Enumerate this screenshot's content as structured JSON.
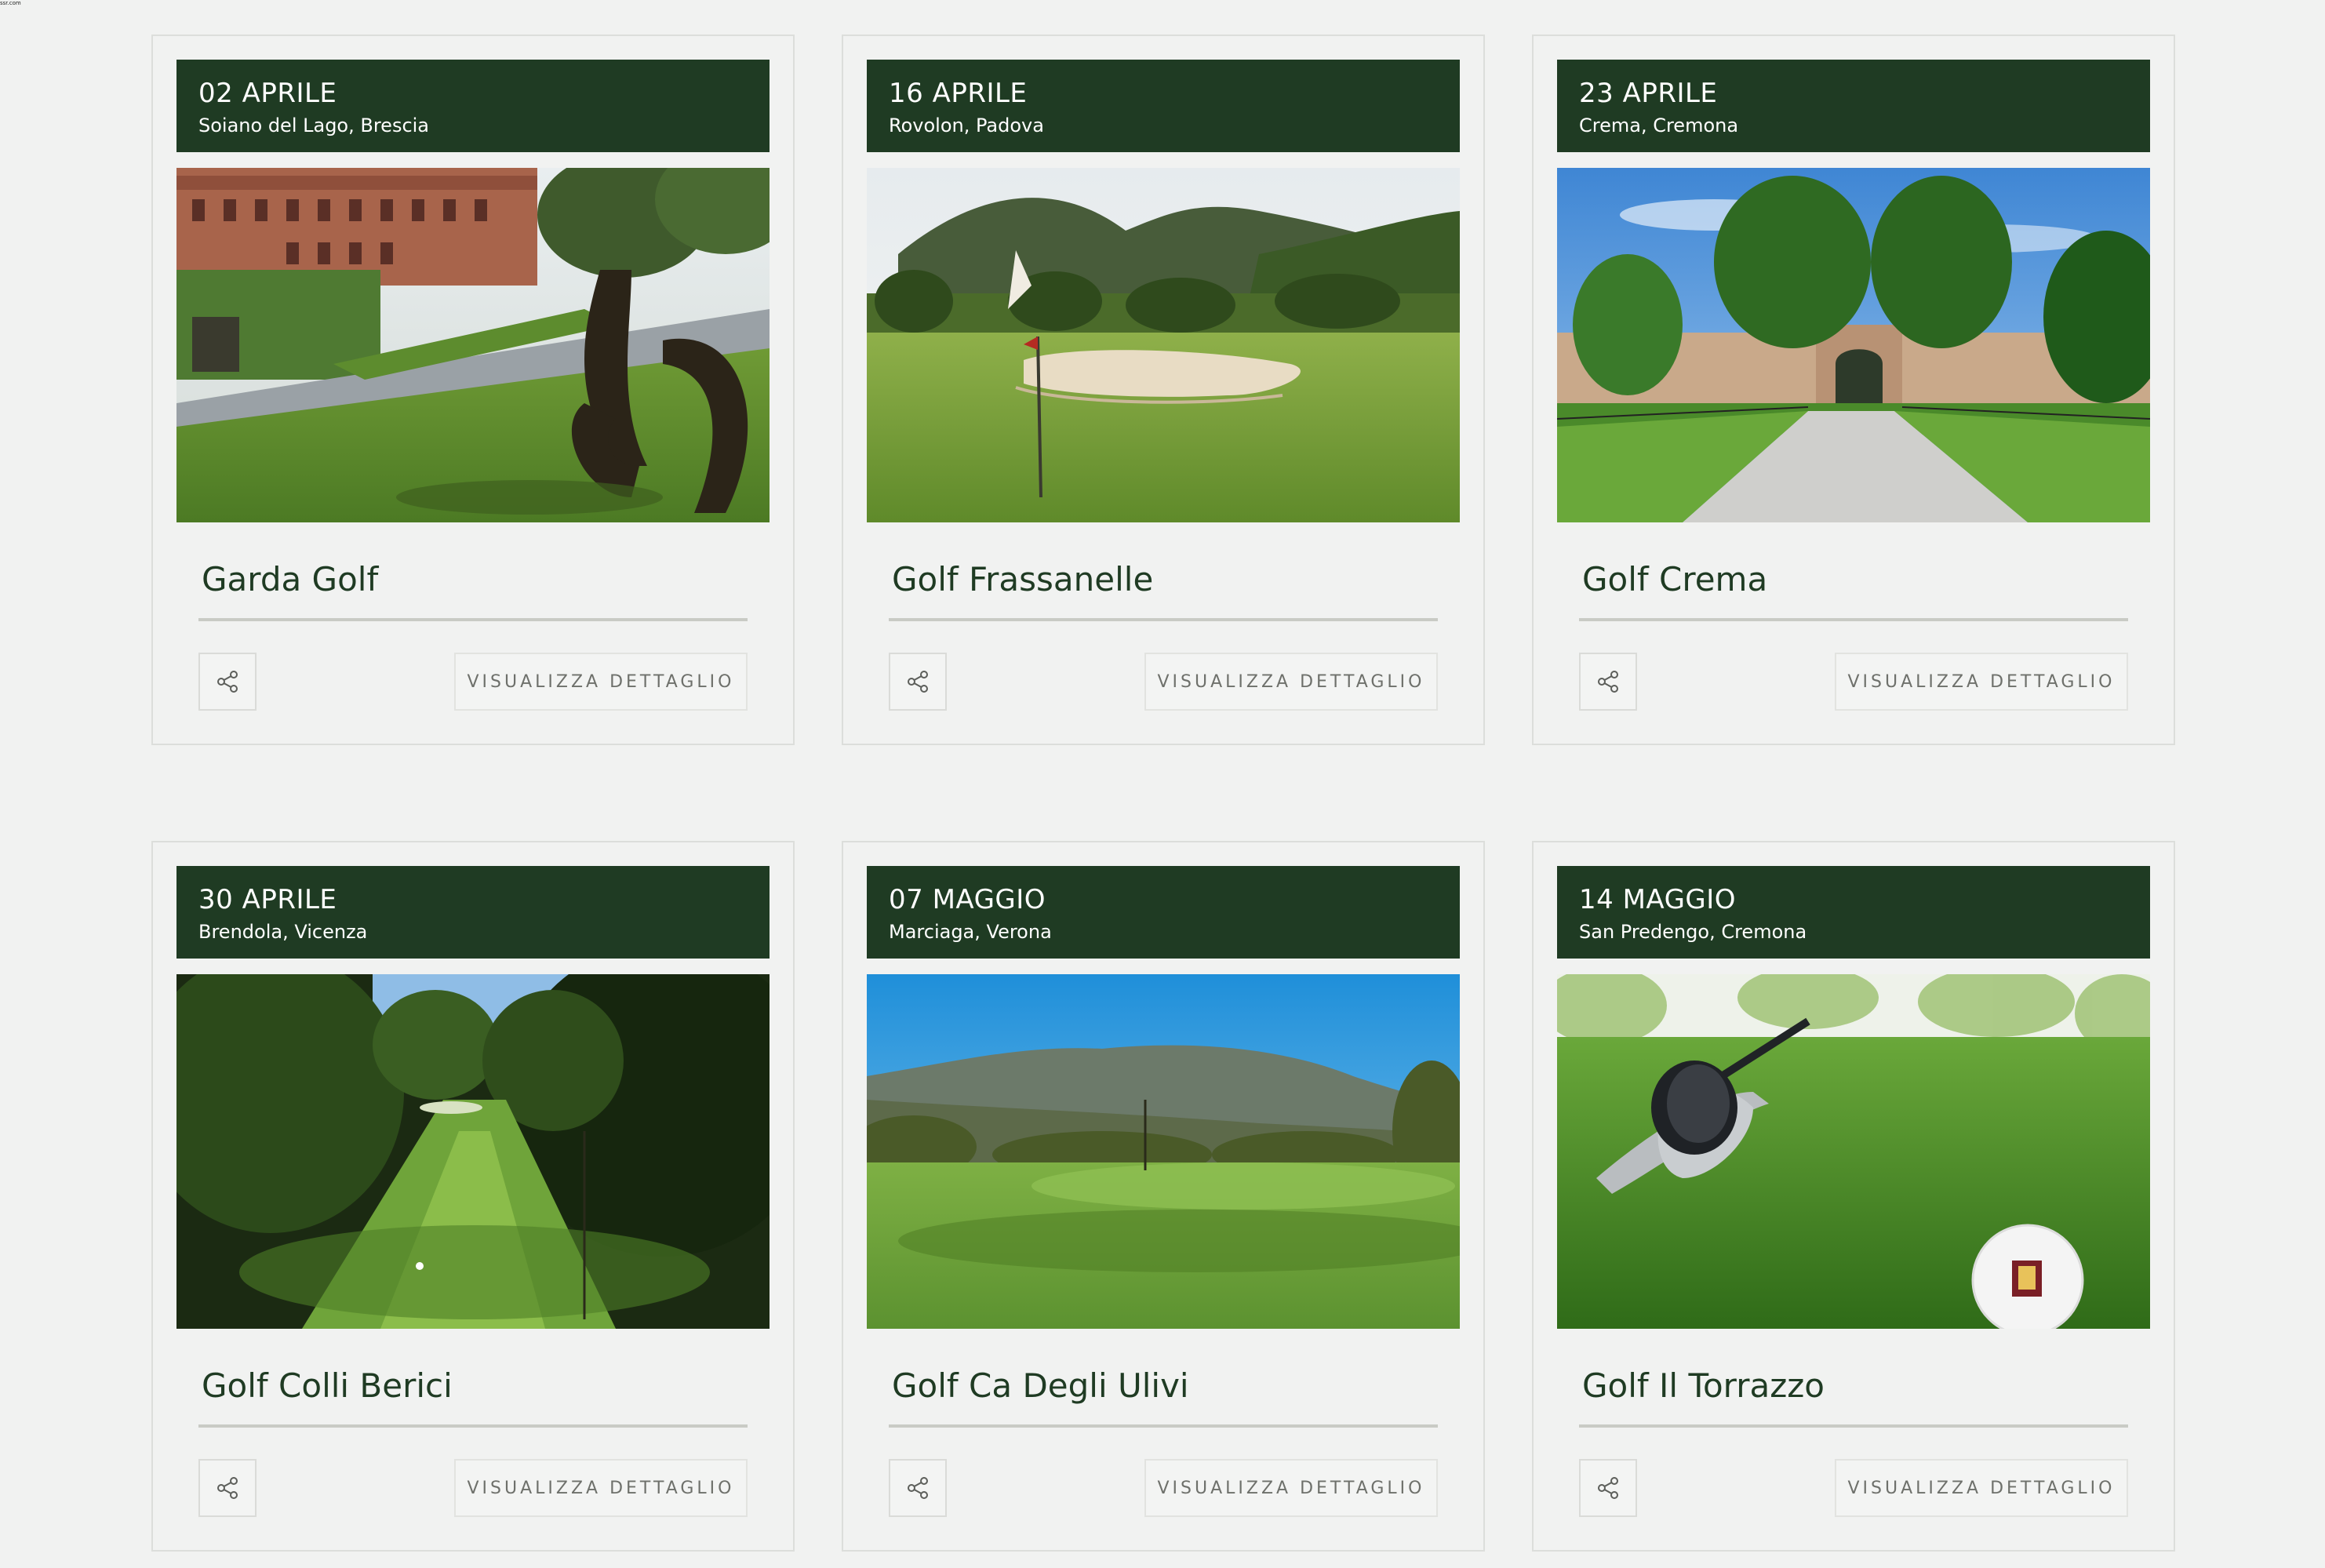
{
  "page": {
    "corner_text": "ssr.com"
  },
  "cards": [
    {
      "date": "02 APRILE",
      "location": "Soiano del Lago, Brescia",
      "title": "Garda Golf",
      "image": "garda-golf-photo",
      "detail_label": "VISUALIZZA DETTAGLIO",
      "share_icon": "share-icon"
    },
    {
      "date": "16 APRILE",
      "location": "Rovolon, Padova",
      "title": "Golf Frassanelle",
      "image": "golf-frassanelle-photo",
      "detail_label": "VISUALIZZA DETTAGLIO",
      "share_icon": "share-icon"
    },
    {
      "date": "23 APRILE",
      "location": "Crema, Cremona",
      "title": "Golf Crema",
      "image": "golf-crema-photo",
      "detail_label": "VISUALIZZA DETTAGLIO",
      "share_icon": "share-icon"
    },
    {
      "date": "30 APRILE",
      "location": "Brendola, Vicenza",
      "title": "Golf Colli Berici",
      "image": "golf-colli-berici-photo",
      "detail_label": "VISUALIZZA DETTAGLIO",
      "share_icon": "share-icon"
    },
    {
      "date": "07 MAGGIO",
      "location": "Marciaga, Verona",
      "title": "Golf Ca Degli Ulivi",
      "image": "golf-ca-degli-ulivi-photo",
      "detail_label": "VISUALIZZA DETTAGLIO",
      "share_icon": "share-icon"
    },
    {
      "date": "14 MAGGIO",
      "location": "San Predengo, Cremona",
      "title": "Golf Il Torrazzo",
      "image": "golf-il-torrazzo-photo",
      "detail_label": "VISUALIZZA DETTAGLIO",
      "share_icon": "share-icon"
    }
  ],
  "colors": {
    "background": "#f1f2f1",
    "header_green": "#1f3b23",
    "title_green": "#1f3b23",
    "divider": "#c9cbc5",
    "button_text": "#6e706b"
  }
}
